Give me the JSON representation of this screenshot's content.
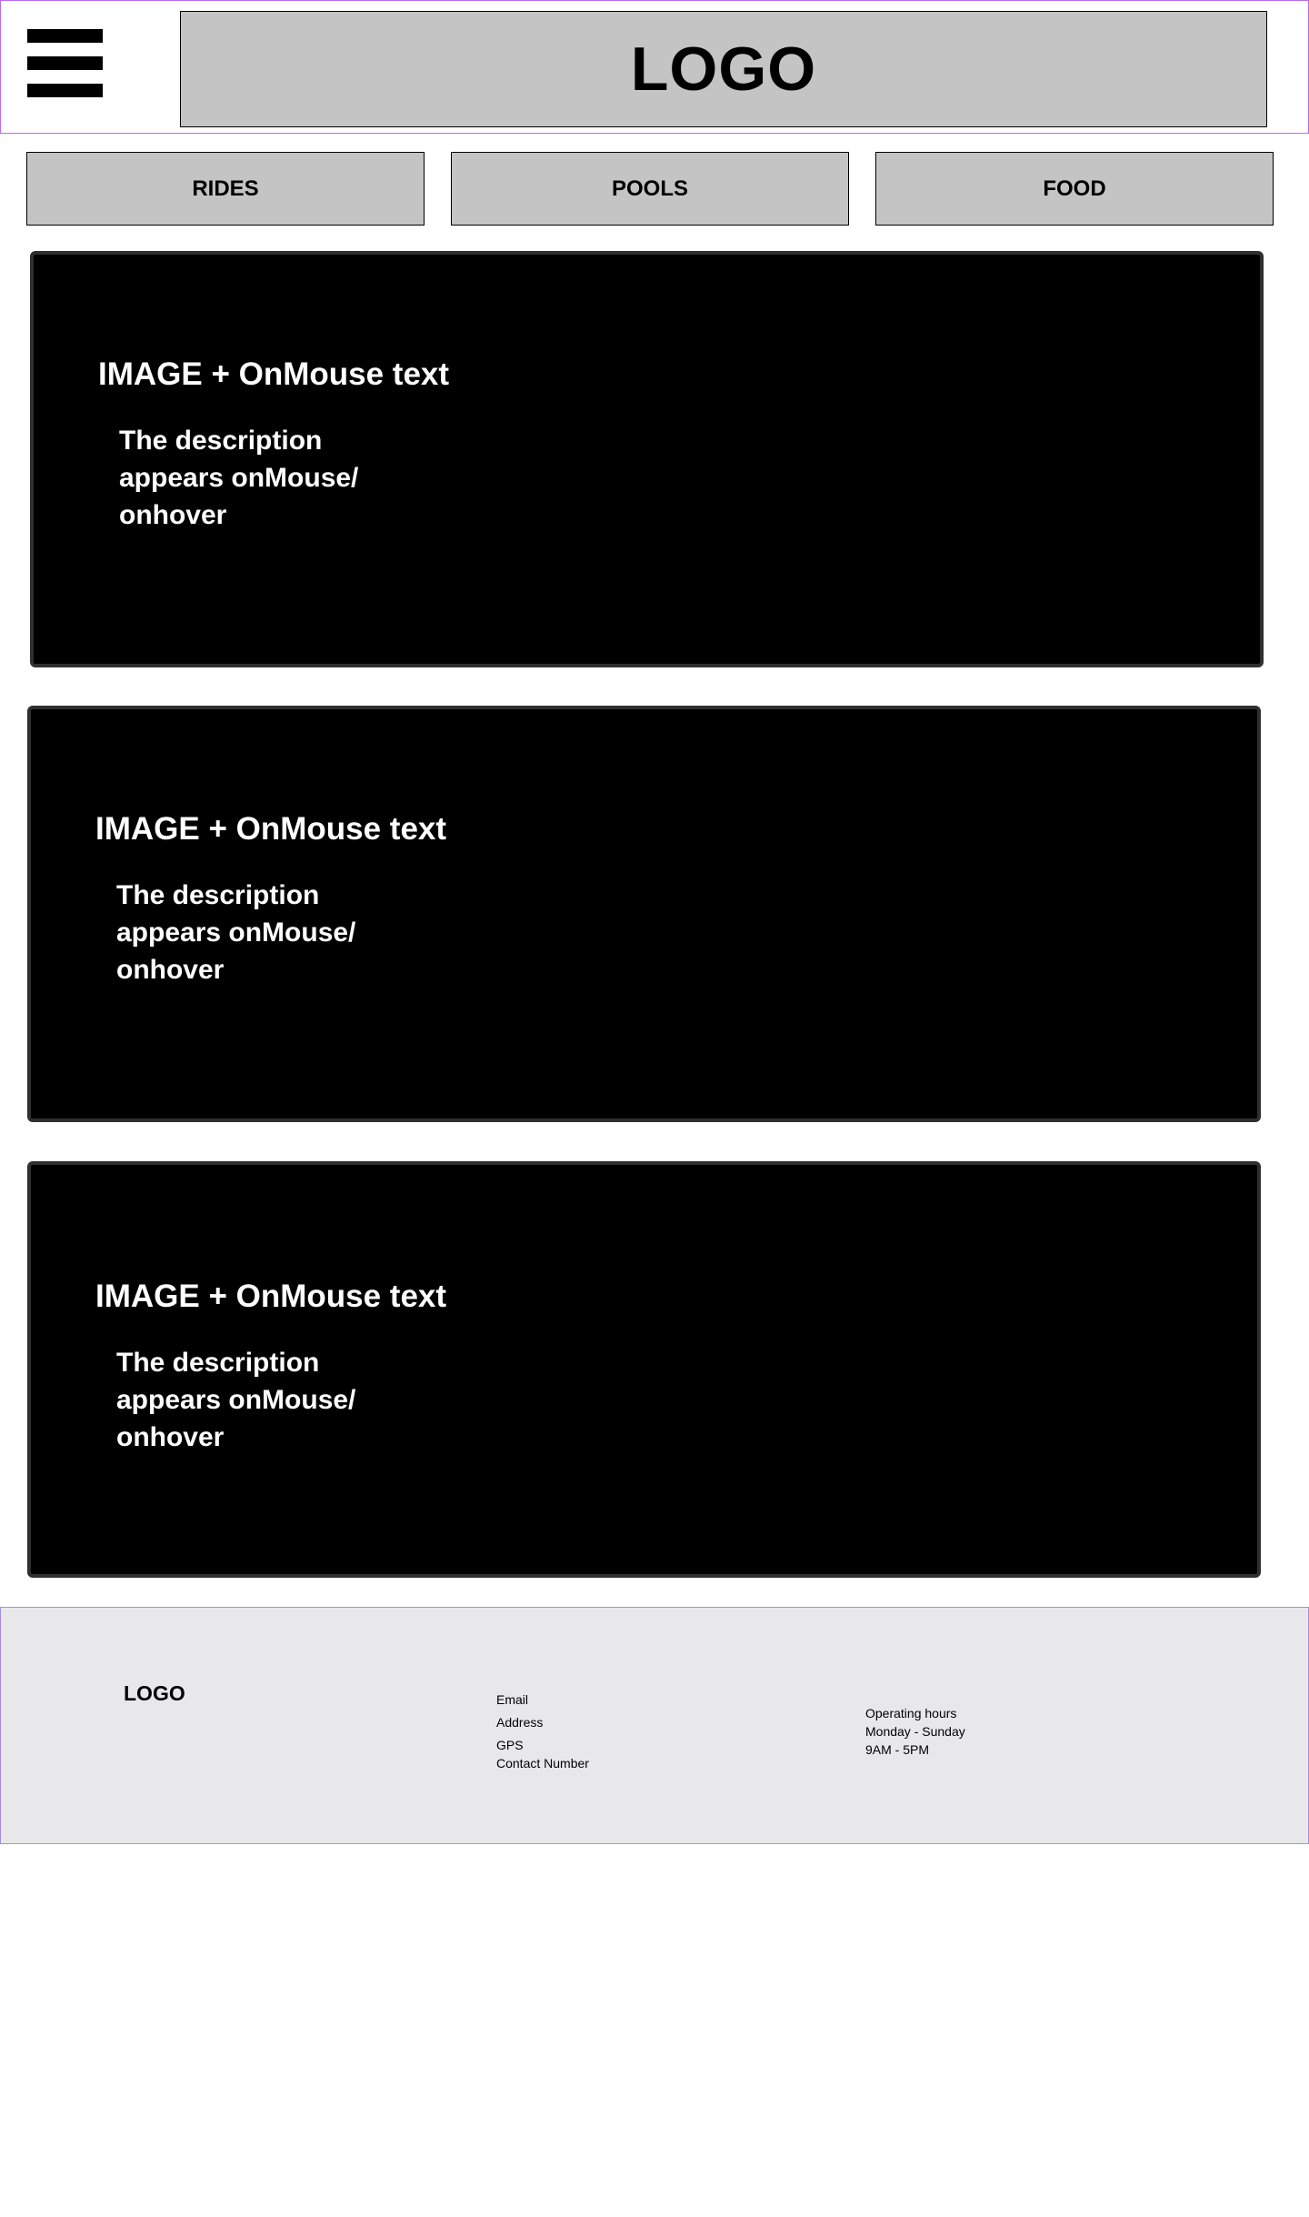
{
  "header": {
    "menu_icon": "hamburger-menu-icon",
    "logo": "LOGO"
  },
  "nav": {
    "items": [
      {
        "label": "RIDES"
      },
      {
        "label": "POOLS"
      },
      {
        "label": "FOOD"
      }
    ]
  },
  "cards": [
    {
      "title": "IMAGE + OnMouse text",
      "description": "The description appears onMouse/ onhover"
    },
    {
      "title": "IMAGE + OnMouse text",
      "description": "The description appears onMouse/ onhover"
    },
    {
      "title": "IMAGE + OnMouse text",
      "description": "The description appears onMouse/ onhover"
    }
  ],
  "footer": {
    "logo": "LOGO",
    "contact": {
      "email": "Email",
      "address": "Address",
      "gps": "GPS",
      "contact_number": "Contact Number"
    },
    "hours": {
      "heading": "Operating hours",
      "days": "Monday - Sunday",
      "time": "9AM - 5PM"
    }
  },
  "colors": {
    "header_border": "#b36bf0",
    "placeholder_gray": "#c4c4c4",
    "card_background": "#000000",
    "footer_background": "#e8e8ea"
  }
}
